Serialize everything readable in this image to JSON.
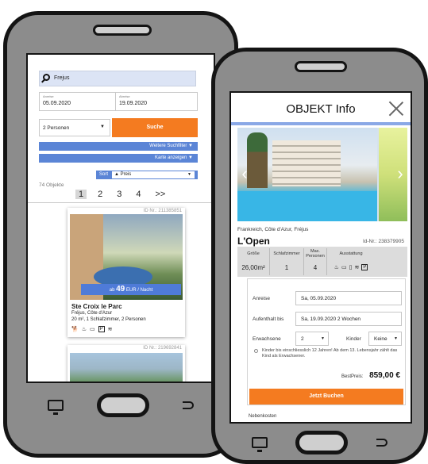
{
  "list_screen": {
    "search": {
      "value": "Frejus"
    },
    "arrival": {
      "label": "Anreise",
      "value": "05.09.2020"
    },
    "departure": {
      "label": "Abreise",
      "value": "19.09.2020"
    },
    "persons": {
      "value": "2 Personen"
    },
    "search_button": "Suche",
    "more_filters": "Weitere Suchfilter ▼",
    "show_map": "Karte anzeigen ▼",
    "sort": {
      "label": "Sort",
      "value": "▲ Preis"
    },
    "count": "74 Objekte",
    "pager": [
      "1",
      "2",
      "3",
      "4",
      ">>"
    ],
    "cards": [
      {
        "id": "ID Nr.: 211385851",
        "price_prefix": "ab",
        "price": "49",
        "price_suffix": "EUR / Nacht",
        "title": "Ste Croix le Parc",
        "location": "Fréjus, Côte d'Azur",
        "details": "20 m², 1 Schlafzimmer, 2 Personen"
      },
      {
        "id": "ID Nr.: 219692841"
      }
    ],
    "amenity_icons": [
      "dog-icon",
      "bbq-icon",
      "tv-icon",
      "parking-icon",
      "wifi-icon"
    ]
  },
  "detail_screen": {
    "title": "OBJEKT Info",
    "region": "Frankreich, Côte d'Azur, Fréjus",
    "name": "L'Open",
    "id": "Id-Nr.: 238379905",
    "facts": {
      "size_label": "Größe",
      "size_value": "26,00m²",
      "bedrooms_label": "Schlafzimmer",
      "bedrooms_value": "1",
      "max_label": "Max. Personen",
      "max_value": "4",
      "equipment_label": "Ausstattung"
    },
    "form": {
      "arrival_label": "Anreise",
      "arrival_value": "Sa, 05.09.2020",
      "stay_label": "Aufenthalt bis",
      "stay_value": "Sa, 19.09.2020  2 Wochen",
      "adults_label": "Erwachsene",
      "adults_value": "2",
      "children_label": "Kinder",
      "children_value": "Keine",
      "kids_note": "Kinder bis einschliesslich 12 Jahren! Ab dem 13. Lebensjahr zählt das Kind als Erwachsener.",
      "best_price_label": "BestPreis:",
      "best_price_value": "859,00 €",
      "book_button": "Jetzt Buchen"
    },
    "extra_costs": "Nebenkosten"
  },
  "colors": {
    "accent_orange": "#f47b20",
    "accent_blue": "#5b85d6",
    "phone_frame": "#8c8c8c"
  }
}
